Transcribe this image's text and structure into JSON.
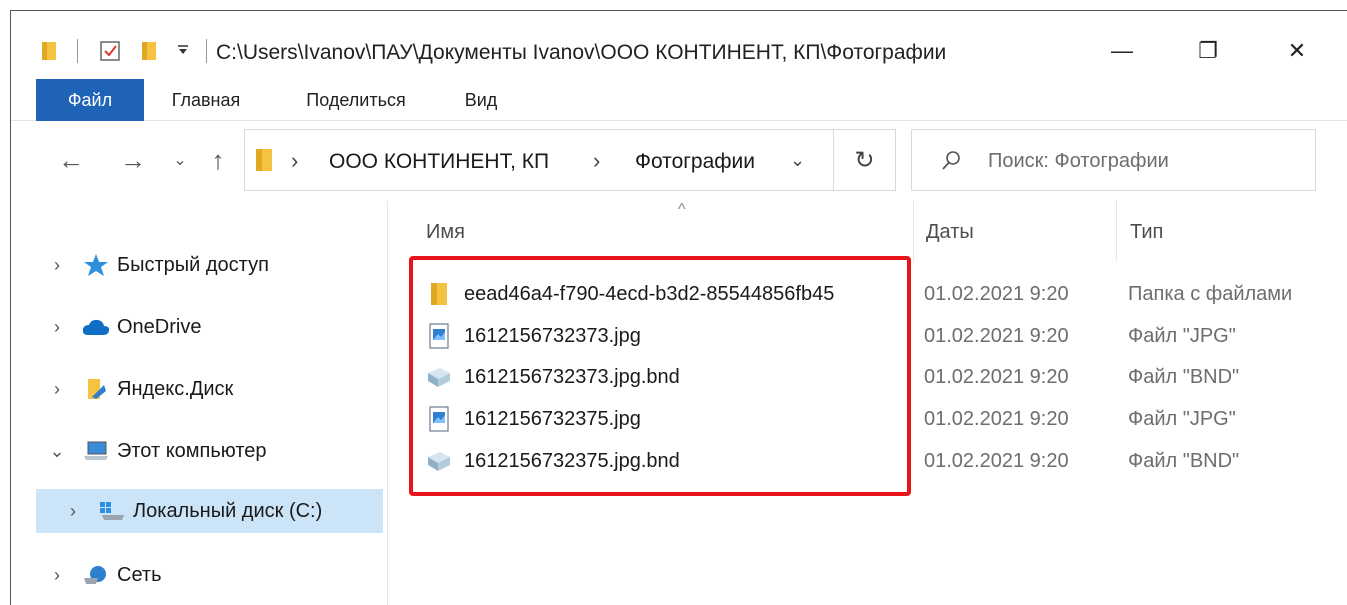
{
  "window": {
    "title": "C:\\Users\\Ivanov\\ПАУ\\Документы Ivanov\\ООО КОНТИНЕНТ, КП\\Фотографии"
  },
  "quick_access": {
    "icons": [
      "folder-icon",
      "properties-check-icon",
      "new-folder-icon",
      "customize-dropdown-icon"
    ]
  },
  "window_controls": {
    "minimize": "—",
    "maximize": "❐",
    "close": "✕"
  },
  "ribbon": {
    "tabs": [
      {
        "label": "Файл"
      },
      {
        "label": "Главная"
      },
      {
        "label": "Поделиться"
      },
      {
        "label": "Вид"
      }
    ]
  },
  "nav": {
    "back": "←",
    "forward": "→",
    "recent": "⌄",
    "up": "↑",
    "breadcrumb": [
      "ООО КОНТИНЕНТ, КП",
      "Фотографии"
    ],
    "chevron": "›",
    "dropdown": "⌄",
    "refresh": "↻"
  },
  "search": {
    "placeholder": "Поиск: Фотографии"
  },
  "sidebar": {
    "items": [
      {
        "label": "Быстрый доступ",
        "chevron": "›",
        "icon": "star-icon"
      },
      {
        "label": "OneDrive",
        "chevron": "›",
        "icon": "cloud-icon"
      },
      {
        "label": "Яндекс.Диск",
        "chevron": "›",
        "icon": "yandex-disk-icon"
      },
      {
        "label": "Этот компьютер",
        "chevron": "⌄",
        "icon": "computer-icon"
      },
      {
        "label": "Локальный диск (C:)",
        "chevron": "›",
        "icon": "drive-icon"
      },
      {
        "label": "Сеть",
        "chevron": "›",
        "icon": "network-icon"
      }
    ]
  },
  "columns": {
    "name": "Имя",
    "date": "Даты",
    "type": "Тип",
    "sort_indicator": "^"
  },
  "files": [
    {
      "name": "eead46a4-f790-4ecd-b3d2-85544856fb45",
      "date": "01.02.2021 9:20",
      "type": "Папка с файлами",
      "icon": "folder-icon"
    },
    {
      "name": "1612156732373.jpg",
      "date": "01.02.2021 9:20",
      "type": "Файл \"JPG\"",
      "icon": "image-file-icon"
    },
    {
      "name": "1612156732373.jpg.bnd",
      "date": "01.02.2021 9:20",
      "type": "Файл \"BND\"",
      "icon": "bnd-file-icon"
    },
    {
      "name": "1612156732375.jpg",
      "date": "01.02.2021 9:20",
      "type": "Файл \"JPG\"",
      "icon": "image-file-icon"
    },
    {
      "name": "1612156732375.jpg.bnd",
      "date": "01.02.2021 9:20",
      "type": "Файл \"BND\"",
      "icon": "bnd-file-icon"
    }
  ],
  "colors": {
    "file_tab": "#1e63b6",
    "selection": "#cce4f7",
    "highlight_border": "#e8141c",
    "folder": "#f5c242"
  }
}
